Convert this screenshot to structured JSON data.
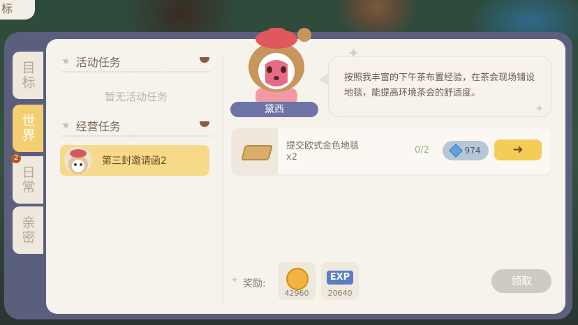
{
  "top_corner_tab": "标",
  "side_tabs": [
    {
      "label": "目标",
      "active": false
    },
    {
      "label": "世界",
      "active": true
    },
    {
      "label": "日常",
      "active": false,
      "badge": "2"
    },
    {
      "label": "亲密",
      "active": false
    }
  ],
  "sections": {
    "active_tasks": {
      "title": "活动任务",
      "empty_text": "暂无活动任务"
    },
    "business_tasks": {
      "title": "经营任务",
      "items": [
        {
          "label": "第三封邀请函2"
        }
      ]
    }
  },
  "npc": {
    "name": "黛西",
    "dialogue": "按照我丰富的下午茶布置经验，在茶会现场铺设地毯，能提高环境茶会的舒适度。"
  },
  "requirement": {
    "item_name": "提交欧式金色地毯",
    "quantity": "x2",
    "progress": "0/2",
    "cost": "974"
  },
  "rewards": {
    "label": "奖励:",
    "items": [
      {
        "icon": "gold-coin-icon",
        "amount": "42960"
      },
      {
        "icon": "exp-icon",
        "label": "EXP",
        "amount": "20640"
      }
    ]
  },
  "claim_button": "领取",
  "colors": {
    "accent_yellow": "#f7d98a",
    "name_tag": "#6e74a6",
    "frame": "#5a5f7e"
  }
}
